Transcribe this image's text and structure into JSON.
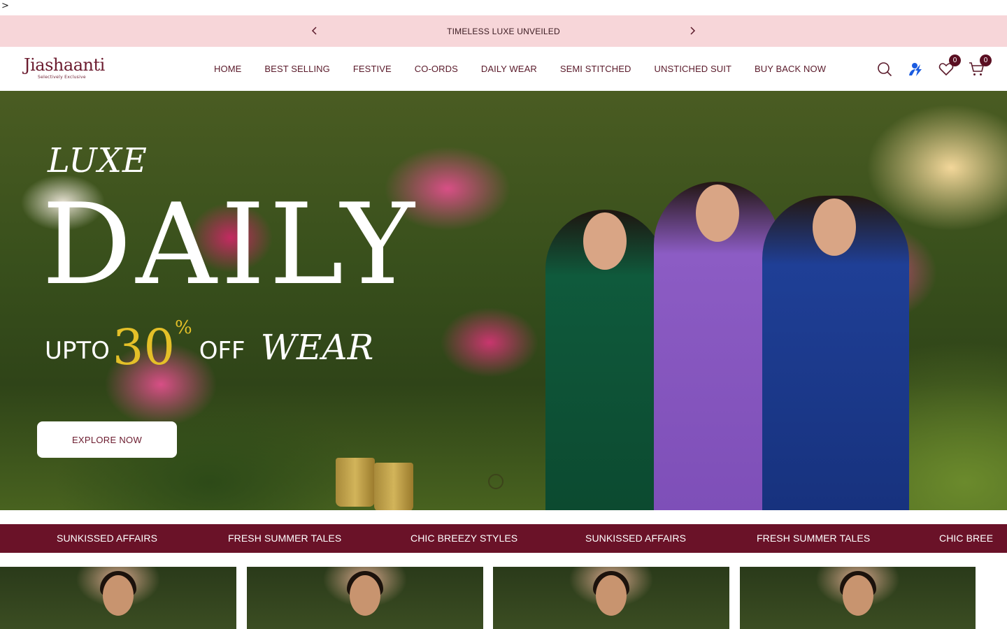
{
  "stray_char": ">",
  "announcement": {
    "message": "TIMELESS LUXE UNVEILED"
  },
  "brand": {
    "name": "Jiashaanti",
    "tagline": "Selectively Exclusive"
  },
  "nav": {
    "items": [
      "HOME",
      "BEST SELLING",
      "FESTIVE",
      "CO-ORDS",
      "DAILY WEAR",
      "SEMI STITCHED",
      "UNSTICHED SUIT",
      "BUY BACK NOW"
    ]
  },
  "header_icons": {
    "search": "search-icon",
    "account": "user-icon",
    "wishlist": "heart-icon",
    "cart": "cart-icon",
    "wishlist_count": "0",
    "cart_count": "0"
  },
  "hero": {
    "line1": "LUXE",
    "line2": "DAILY",
    "upto": "UPTO",
    "percent": "30",
    "percent_sign": "%",
    "off": "OFF",
    "wear": "WEAR",
    "cta": "EXPLORE NOW"
  },
  "ticker": {
    "items": [
      "SUNKISSED AFFAIRS",
      "FRESH SUMMER TALES",
      "CHIC BREEZY STYLES",
      "SUNKISSED AFFAIRS",
      "FRESH SUMMER TALES",
      "CHIC BREE"
    ]
  },
  "colors": {
    "announcement_bg": "#f7d6d9",
    "brand": "#6b1b2e",
    "ticker_bg": "#6a1228",
    "accent_gold": "#e4c028",
    "account_icon_blue": "#1a5be0"
  }
}
